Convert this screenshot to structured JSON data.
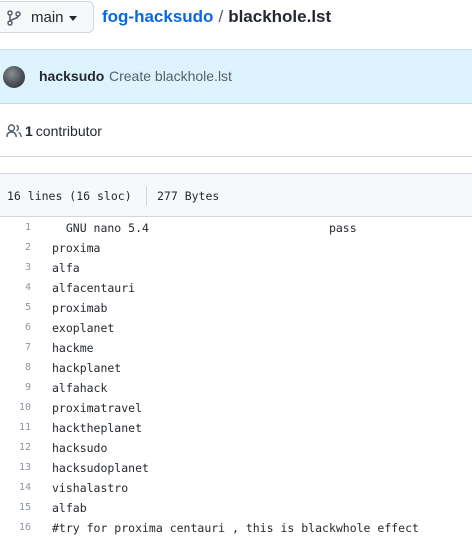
{
  "branch": {
    "name": "main"
  },
  "breadcrumb": {
    "repo": "fog-hacksudo",
    "separator": "/",
    "file": "blackhole.lst"
  },
  "commit": {
    "author": "hacksudo",
    "message": "Create blackhole.lst"
  },
  "contributors": {
    "count": "1",
    "label": "contributor"
  },
  "file_info": {
    "lines": "16 lines (16 sloc)",
    "size": "277 Bytes"
  },
  "lines": [
    {
      "num": "1",
      "text": "  GNU nano 5.4                          pass"
    },
    {
      "num": "2",
      "text": "proxima"
    },
    {
      "num": "3",
      "text": "alfa"
    },
    {
      "num": "4",
      "text": "alfacentauri"
    },
    {
      "num": "5",
      "text": "proximab"
    },
    {
      "num": "6",
      "text": "exoplanet"
    },
    {
      "num": "7",
      "text": "hackme"
    },
    {
      "num": "8",
      "text": "hackplanet"
    },
    {
      "num": "9",
      "text": "alfahack"
    },
    {
      "num": "10",
      "text": "proximatravel"
    },
    {
      "num": "11",
      "text": "hacktheplanet"
    },
    {
      "num": "12",
      "text": "hacksudo"
    },
    {
      "num": "13",
      "text": "hacksudoplanet"
    },
    {
      "num": "14",
      "text": "vishalastro"
    },
    {
      "num": "15",
      "text": "alfab"
    },
    {
      "num": "16",
      "text": "#try for proxima centauri , this is blackwhole effect"
    }
  ]
}
